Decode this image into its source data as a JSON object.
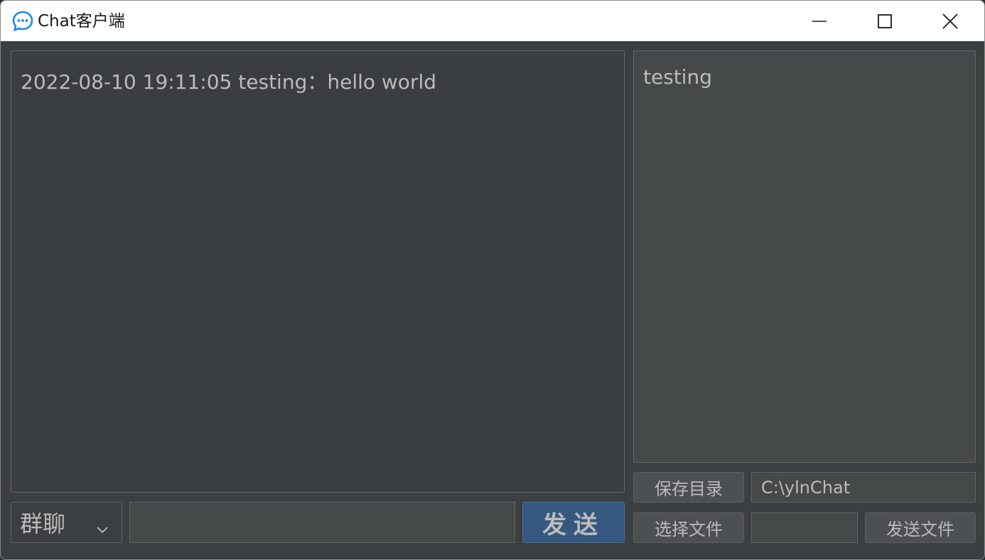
{
  "window": {
    "title": "Chat客户端"
  },
  "chat": {
    "messages": [
      "2022-08-10 19:11:05 testing：hello world"
    ]
  },
  "users": [
    "testing"
  ],
  "controls": {
    "mode_select_value": "群聊",
    "message_input_value": "",
    "send_label": "发送",
    "save_dir_label": "保存目录",
    "save_dir_value": "C:\\ylnChat",
    "choose_file_label": "选择文件",
    "file_field_value": "",
    "send_file_label": "发送文件"
  },
  "colors": {
    "background": "#3c3f41",
    "accent": "#365880",
    "text": "#bbbbbb",
    "titlebar": "#ffffff",
    "app_icon": "#1e88e5"
  },
  "icons": {
    "app": "chat-bubble-icon",
    "minimize": "minimize-icon",
    "maximize": "maximize-icon",
    "close": "close-icon",
    "dropdown": "chevron-down-icon"
  }
}
